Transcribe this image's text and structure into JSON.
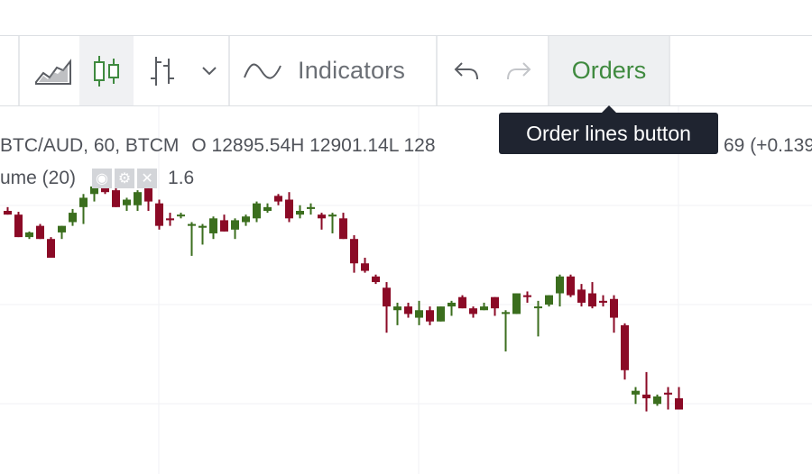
{
  "toolbar": {
    "indicators_label": "Indicators",
    "orders_label": "Orders",
    "icons": [
      "area-chart-icon",
      "candlestick-icon",
      "bar-chart-icon",
      "chevron-down-icon",
      "indicators-wave-icon",
      "undo-icon",
      "redo-icon"
    ]
  },
  "tooltip": {
    "text": "Order lines button"
  },
  "legend": {
    "symbol": "BTC/AUD, 60, BTCM",
    "ohlc": "O 12895.54H 12901.14L 128",
    "change": "69 (+0.139",
    "volume_label": "ume (20)",
    "volume_value": "1.6"
  },
  "colors": {
    "up": "#3b6e1e",
    "down": "#8b0a26",
    "accent": "#3f8a3f",
    "tooltip_bg": "#1f2430"
  },
  "chart_data": {
    "type": "candlestick",
    "note_units": "relative price level",
    "candles": [
      {
        "o": 100,
        "h": 104,
        "l": 96,
        "c": 96
      },
      {
        "o": 96,
        "h": 99,
        "l": 72,
        "c": 72
      },
      {
        "o": 72,
        "h": 78,
        "l": 70,
        "c": 77
      },
      {
        "o": 84,
        "h": 86,
        "l": 70,
        "c": 70
      },
      {
        "o": 70,
        "h": 72,
        "l": 50,
        "c": 50
      },
      {
        "o": 77,
        "h": 84,
        "l": 70,
        "c": 84
      },
      {
        "o": 88,
        "h": 102,
        "l": 84,
        "c": 98
      },
      {
        "o": 104,
        "h": 118,
        "l": 86,
        "c": 114
      },
      {
        "o": 118,
        "h": 126,
        "l": 110,
        "c": 126
      },
      {
        "o": 126,
        "h": 130,
        "l": 118,
        "c": 120
      },
      {
        "o": 122,
        "h": 126,
        "l": 104,
        "c": 104
      },
      {
        "o": 106,
        "h": 114,
        "l": 100,
        "c": 112
      },
      {
        "o": 106,
        "h": 122,
        "l": 100,
        "c": 120
      },
      {
        "o": 124,
        "h": 128,
        "l": 100,
        "c": 110
      },
      {
        "o": 108,
        "h": 112,
        "l": 80,
        "c": 84
      },
      {
        "o": 92,
        "h": 98,
        "l": 84,
        "c": 90
      },
      {
        "o": 96,
        "h": 98,
        "l": 92,
        "c": 96
      },
      {
        "o": 84,
        "h": 88,
        "l": 52,
        "c": 86
      },
      {
        "o": 82,
        "h": 86,
        "l": 64,
        "c": 84
      },
      {
        "o": 76,
        "h": 94,
        "l": 70,
        "c": 92
      },
      {
        "o": 90,
        "h": 96,
        "l": 78,
        "c": 78
      },
      {
        "o": 80,
        "h": 92,
        "l": 70,
        "c": 90
      },
      {
        "o": 88,
        "h": 96,
        "l": 84,
        "c": 94
      },
      {
        "o": 92,
        "h": 110,
        "l": 88,
        "c": 108
      },
      {
        "o": 100,
        "h": 108,
        "l": 98,
        "c": 104
      },
      {
        "o": 116,
        "h": 118,
        "l": 106,
        "c": 110
      },
      {
        "o": 112,
        "h": 120,
        "l": 88,
        "c": 92
      },
      {
        "o": 96,
        "h": 106,
        "l": 92,
        "c": 100
      },
      {
        "o": 102,
        "h": 108,
        "l": 96,
        "c": 104
      },
      {
        "o": 96,
        "h": 98,
        "l": 80,
        "c": 92
      },
      {
        "o": 94,
        "h": 98,
        "l": 76,
        "c": 96
      },
      {
        "o": 92,
        "h": 98,
        "l": 70,
        "c": 70
      },
      {
        "o": 70,
        "h": 74,
        "l": 34,
        "c": 44
      },
      {
        "o": 44,
        "h": 50,
        "l": 34,
        "c": 36
      },
      {
        "o": 30,
        "h": 32,
        "l": 22,
        "c": 24
      },
      {
        "o": 18,
        "h": 24,
        "l": -30,
        "c": -2
      },
      {
        "o": -6,
        "h": 2,
        "l": -22,
        "c": -2
      },
      {
        "o": -2,
        "h": 2,
        "l": -14,
        "c": -10
      },
      {
        "o": -14,
        "h": 4,
        "l": -22,
        "c": -6
      },
      {
        "o": -6,
        "h": -2,
        "l": -22,
        "c": -18
      },
      {
        "o": -18,
        "h": -2,
        "l": -18,
        "c": -2
      },
      {
        "o": -2,
        "h": 4,
        "l": -12,
        "c": 2
      },
      {
        "o": 8,
        "h": 10,
        "l": -4,
        "c": -4
      },
      {
        "o": -4,
        "h": -2,
        "l": -14,
        "c": -10
      },
      {
        "o": -6,
        "h": 2,
        "l": -6,
        "c": -2
      },
      {
        "o": 8,
        "h": 8,
        "l": -12,
        "c": -4
      },
      {
        "o": -10,
        "h": -6,
        "l": -50,
        "c": -8
      },
      {
        "o": -10,
        "h": 12,
        "l": -10,
        "c": 12
      },
      {
        "o": 10,
        "h": 14,
        "l": 2,
        "c": 8
      },
      {
        "o": -2,
        "h": 4,
        "l": -34,
        "c": -2
      },
      {
        "o": 0,
        "h": 10,
        "l": -2,
        "c": 10
      },
      {
        "o": 12,
        "h": 32,
        "l": -2,
        "c": 30
      },
      {
        "o": 30,
        "h": 32,
        "l": 8,
        "c": 10
      },
      {
        "o": 16,
        "h": 22,
        "l": -2,
        "c": 2
      },
      {
        "o": 12,
        "h": 24,
        "l": -4,
        "c": -2
      },
      {
        "o": 4,
        "h": 10,
        "l": -2,
        "c": 2
      },
      {
        "o": 6,
        "h": 10,
        "l": -30,
        "c": -14
      },
      {
        "o": -22,
        "h": -20,
        "l": -80,
        "c": -70
      },
      {
        "o": -96,
        "h": -88,
        "l": -106,
        "c": -92
      },
      {
        "o": -96,
        "h": -72,
        "l": -114,
        "c": -100
      },
      {
        "o": -106,
        "h": -96,
        "l": -108,
        "c": -98
      },
      {
        "o": -94,
        "h": -88,
        "l": -112,
        "c": -96
      },
      {
        "o": -100,
        "h": -88,
        "l": -112,
        "c": -112
      }
    ]
  }
}
